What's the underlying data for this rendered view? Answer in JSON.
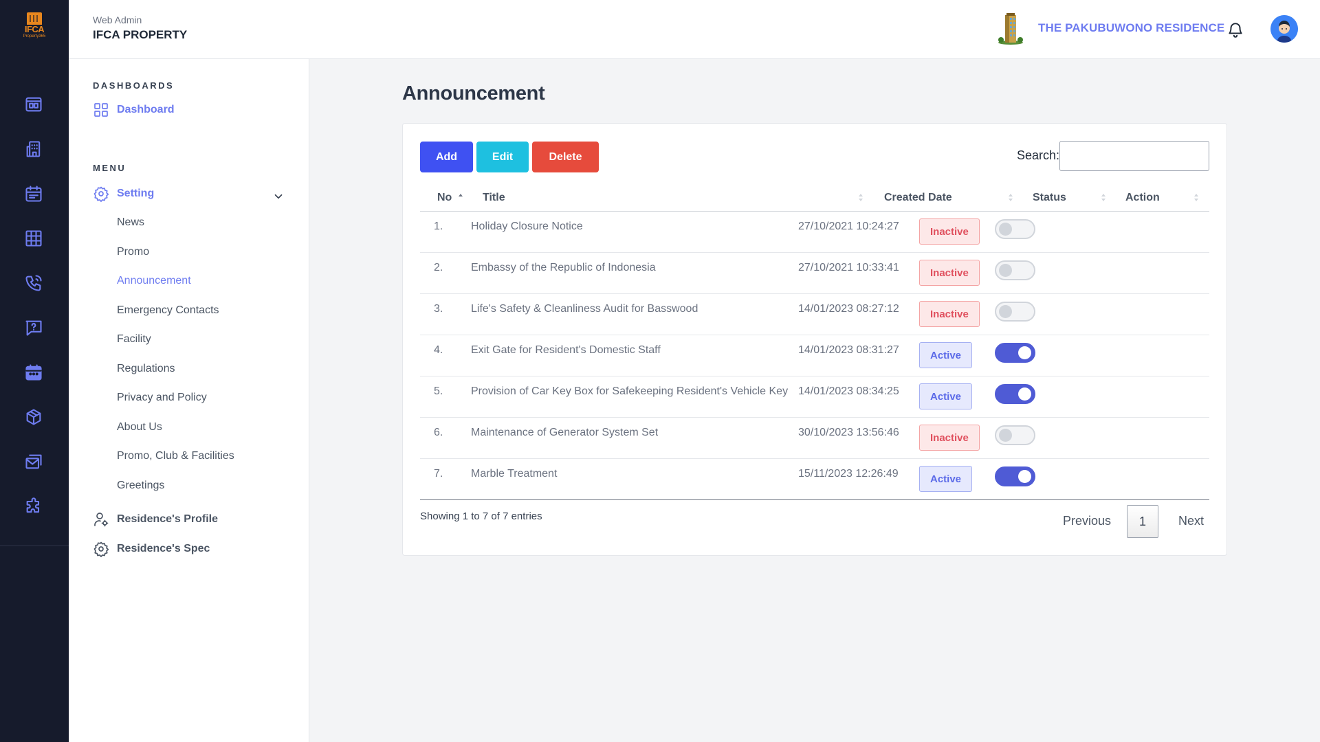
{
  "rail": {
    "logo_text": "IFCA",
    "logo_sub": "Property365",
    "icons": [
      "dashboard-icon",
      "building-icon",
      "calendar-icon",
      "floorplan-icon",
      "phone-icon",
      "help-icon",
      "event-icon",
      "package-icon",
      "mail-icon",
      "puzzle-icon"
    ]
  },
  "header": {
    "subtitle": "Web Admin",
    "title": "IFCA PROPERTY",
    "residence": "THE PAKUBUWONO RESIDENCE"
  },
  "sidebar": {
    "dashboards_heading": "DASHBOARDS",
    "dashboard_label": "Dashboard",
    "menu_heading": "MENU",
    "setting_label": "Setting",
    "setting_items": [
      "News",
      "Promo",
      "Announcement",
      "Emergency Contacts",
      "Facility",
      "Regulations",
      "Privacy and Policy",
      "About Us",
      "Promo, Club & Facilities",
      "Greetings"
    ],
    "active_item": "Announcement",
    "profile_label": "Residence's Profile",
    "spec_label": "Residence's Spec"
  },
  "page": {
    "title": "Announcement",
    "add_label": "Add",
    "edit_label": "Edit",
    "delete_label": "Delete",
    "search_label": "Search:",
    "search_value": "",
    "columns": [
      "No",
      "Title",
      "Created Date",
      "Status",
      "Action"
    ],
    "rows": [
      {
        "no": "1.",
        "title": "Holiday Closure Notice",
        "date": "27/10/2021 10:24:27",
        "status": "Inactive",
        "on": false
      },
      {
        "no": "2.",
        "title": "Embassy of the Republic of Indonesia",
        "date": "27/10/2021 10:33:41",
        "status": "Inactive",
        "on": false
      },
      {
        "no": "3.",
        "title": "Life's Safety & Cleanliness Audit for Basswood",
        "date": "14/01/2023 08:27:12",
        "status": "Inactive",
        "on": false
      },
      {
        "no": "4.",
        "title": "Exit Gate for Resident's Domestic Staff",
        "date": "14/01/2023 08:31:27",
        "status": "Active",
        "on": true
      },
      {
        "no": "5.",
        "title": "Provision of Car Key Box for Safekeeping Resident's Vehicle Key",
        "date": "14/01/2023 08:34:25",
        "status": "Active",
        "on": true
      },
      {
        "no": "6.",
        "title": "Maintenance of Generator System Set",
        "date": "30/10/2023 13:56:46",
        "status": "Inactive",
        "on": false
      },
      {
        "no": "7.",
        "title": "Marble Treatment",
        "date": "15/11/2023 12:26:49",
        "status": "Active",
        "on": true
      }
    ],
    "info": "Showing 1 to 7 of 7 entries",
    "pager": {
      "previous": "Previous",
      "page": "1",
      "next": "Next"
    }
  },
  "colors": {
    "rail_bg": "#161b2c",
    "accent": "#6e7cf0",
    "add_btn": "#3f51f2",
    "edit_btn": "#1ec0e0",
    "delete_btn": "#e64b3c"
  }
}
